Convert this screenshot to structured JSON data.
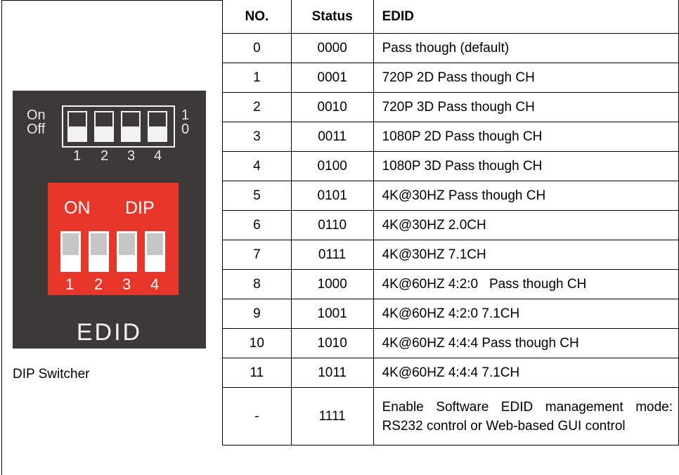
{
  "table": {
    "headers": [
      "NO.",
      "Status",
      "EDID"
    ],
    "rows": [
      {
        "no": "0",
        "status": "0000",
        "edid": "Pass though (default)"
      },
      {
        "no": "1",
        "status": "0001",
        "edid": "720P 2D Pass though CH"
      },
      {
        "no": "2",
        "status": "0010",
        "edid": "720P 3D Pass though CH"
      },
      {
        "no": "3",
        "status": "0011",
        "edid": "1080P 2D Pass though CH"
      },
      {
        "no": "4",
        "status": "0100",
        "edid": "1080P 3D Pass though CH"
      },
      {
        "no": "5",
        "status": "0101",
        "edid": "4K@30HZ Pass though CH"
      },
      {
        "no": "6",
        "status": "0110",
        "edid": "4K@30HZ 2.0CH"
      },
      {
        "no": "7",
        "status": "0111",
        "edid": "4K@30HZ 7.1CH"
      },
      {
        "no": "8",
        "status": "1000",
        "edid": "4K@60HZ 4:2:0   Pass though CH"
      },
      {
        "no": "9",
        "status": "1001",
        "edid": "4K@60HZ 4:2:0 7.1CH"
      },
      {
        "no": "10",
        "status": "1010",
        "edid": "4K@60HZ 4:4:4 Pass though CH"
      },
      {
        "no": "11",
        "status": "1011",
        "edid": "4K@60HZ 4:4:4 7.1CH"
      },
      {
        "no": "-",
        "status": "1111",
        "edid": "Enable Software EDID management mode: RS232 control or Web-based GUI control"
      }
    ]
  },
  "diagram": {
    "on_label": "On",
    "off_label": "Off",
    "one_label": "1",
    "zero_label": "0",
    "switch_numbers": [
      "1",
      "2",
      "3",
      "4"
    ],
    "dip_on_label": "ON",
    "dip_label": "DIP",
    "dip_numbers": [
      "1",
      "2",
      "3",
      "4"
    ],
    "title": "EDID",
    "colors": {
      "panel": "#3c3a38",
      "dip_block": "#e8372a"
    }
  },
  "caption": "DIP Switcher"
}
